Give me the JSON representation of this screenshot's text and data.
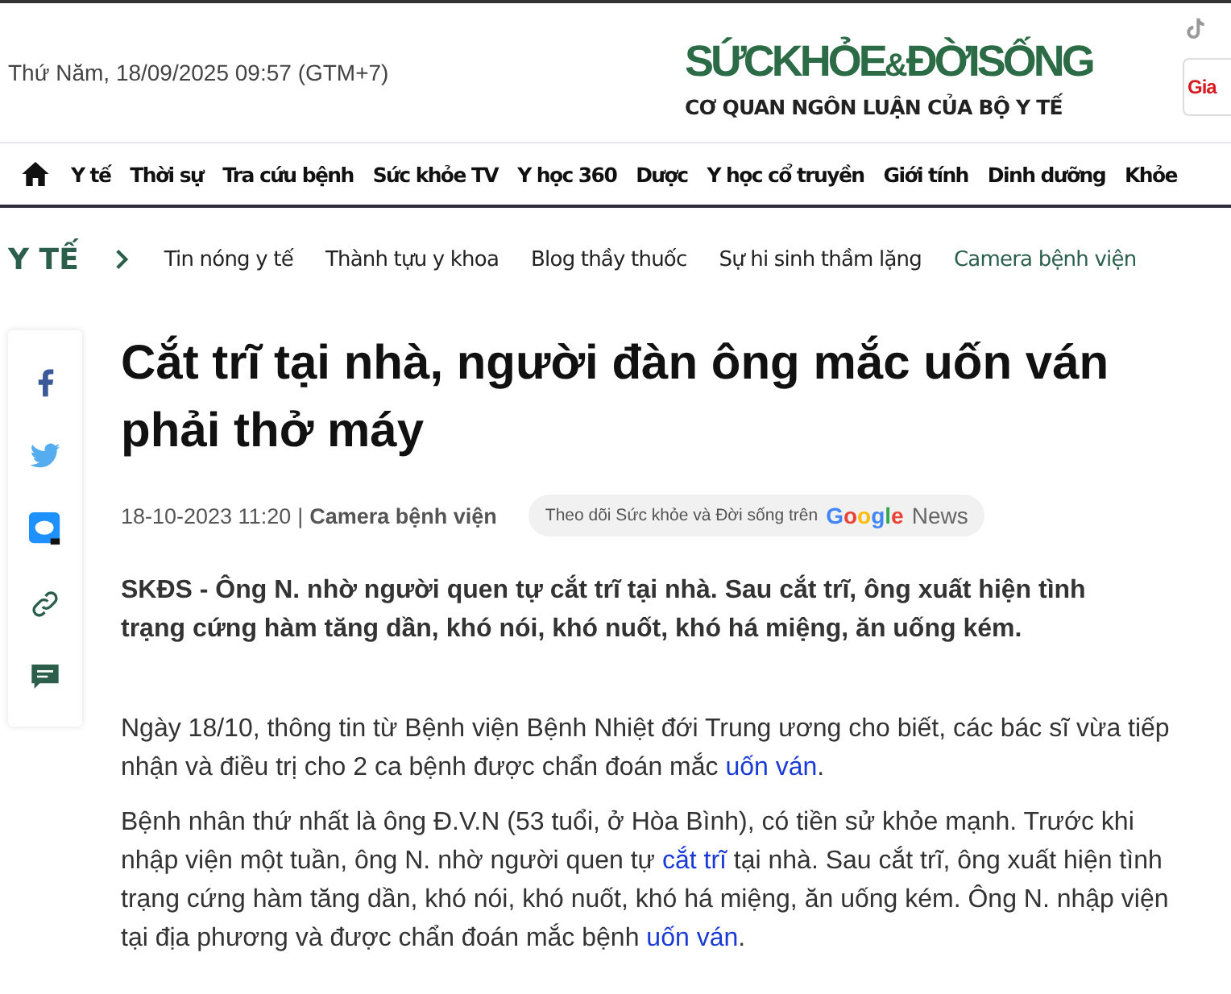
{
  "header": {
    "date": "Thứ Năm, 18/09/2025 09:57 (GTM+7)",
    "logo": {
      "left": "SỨCKHỎE",
      "amp": "&",
      "right": "ĐỜISỐNG",
      "tagline": "CƠ QUAN NGÔN LUẬN CỦA BỘ Y TẾ"
    },
    "badge": "Gia"
  },
  "nav": [
    {
      "label": "Y tế"
    },
    {
      "label": "Thời sự"
    },
    {
      "label": "Tra cứu bệnh"
    },
    {
      "label": "Sức khỏe TV"
    },
    {
      "label": "Y học 360"
    },
    {
      "label": "Dược"
    },
    {
      "label": "Y học cổ truyền"
    },
    {
      "label": "Giới tính"
    },
    {
      "label": "Dinh dưỡng"
    },
    {
      "label": "Khỏe"
    }
  ],
  "subnav": {
    "section": "Y TẾ",
    "items": [
      {
        "label": "Tin nóng y tế",
        "selected": false
      },
      {
        "label": "Thành tựu y khoa",
        "selected": false
      },
      {
        "label": "Blog thầy thuốc",
        "selected": false
      },
      {
        "label": "Sự hi sinh thầm lặng",
        "selected": false
      },
      {
        "label": "Camera bệnh viện",
        "selected": true
      }
    ]
  },
  "share": [
    {
      "kind": "facebook"
    },
    {
      "kind": "twitter"
    },
    {
      "kind": "zalo"
    },
    {
      "kind": "link"
    },
    {
      "kind": "comment"
    }
  ],
  "article": {
    "title": "Cắt trĩ tại nhà, người đàn ông mắc uốn ván phải thở máy",
    "date": "18-10-2023 11:20",
    "separator": "|",
    "category": "Camera bệnh viện",
    "follow": {
      "text": "Theo dõi Sức khỏe và Đời sống trên",
      "brand": "Google",
      "suffix": "News"
    },
    "sapo": "SKĐS - Ông N. nhờ người quen tự cắt trĩ tại nhà. Sau cắt trĩ, ông xuất hiện tình trạng cứng hàm tăng dần, khó nói, khó nuốt, khó há miệng, ăn uống kém.",
    "paragraphs": [
      [
        {
          "kind": "text",
          "text": "Ngày 18/10, thông tin từ Bệnh viện Bệnh Nhiệt đới Trung ương cho biết, các bác sĩ vừa tiếp nhận và điều trị cho 2 ca bệnh được chẩn đoán mắc "
        },
        {
          "kind": "link",
          "text": "uốn ván"
        },
        {
          "kind": "text",
          "text": "."
        }
      ],
      [
        {
          "kind": "text",
          "text": "Bệnh nhân thứ nhất là ông Đ.V.N (53 tuổi, ở Hòa Bình), có tiền sử khỏe mạnh. Trước khi nhập viện một tuần, ông N. nhờ người quen tự "
        },
        {
          "kind": "link",
          "text": "cắt trĩ"
        },
        {
          "kind": "text",
          "text": " tại nhà. Sau cắt trĩ, ông xuất hiện tình trạng cứng hàm tăng dần, khó nói, khó nuốt, khó há miệng, ăn uống kém. Ông N. nhập viện tại địa phương và được chẩn đoán mắc bệnh "
        },
        {
          "kind": "link",
          "text": "uốn ván"
        },
        {
          "kind": "text",
          "text": "."
        }
      ]
    ]
  }
}
